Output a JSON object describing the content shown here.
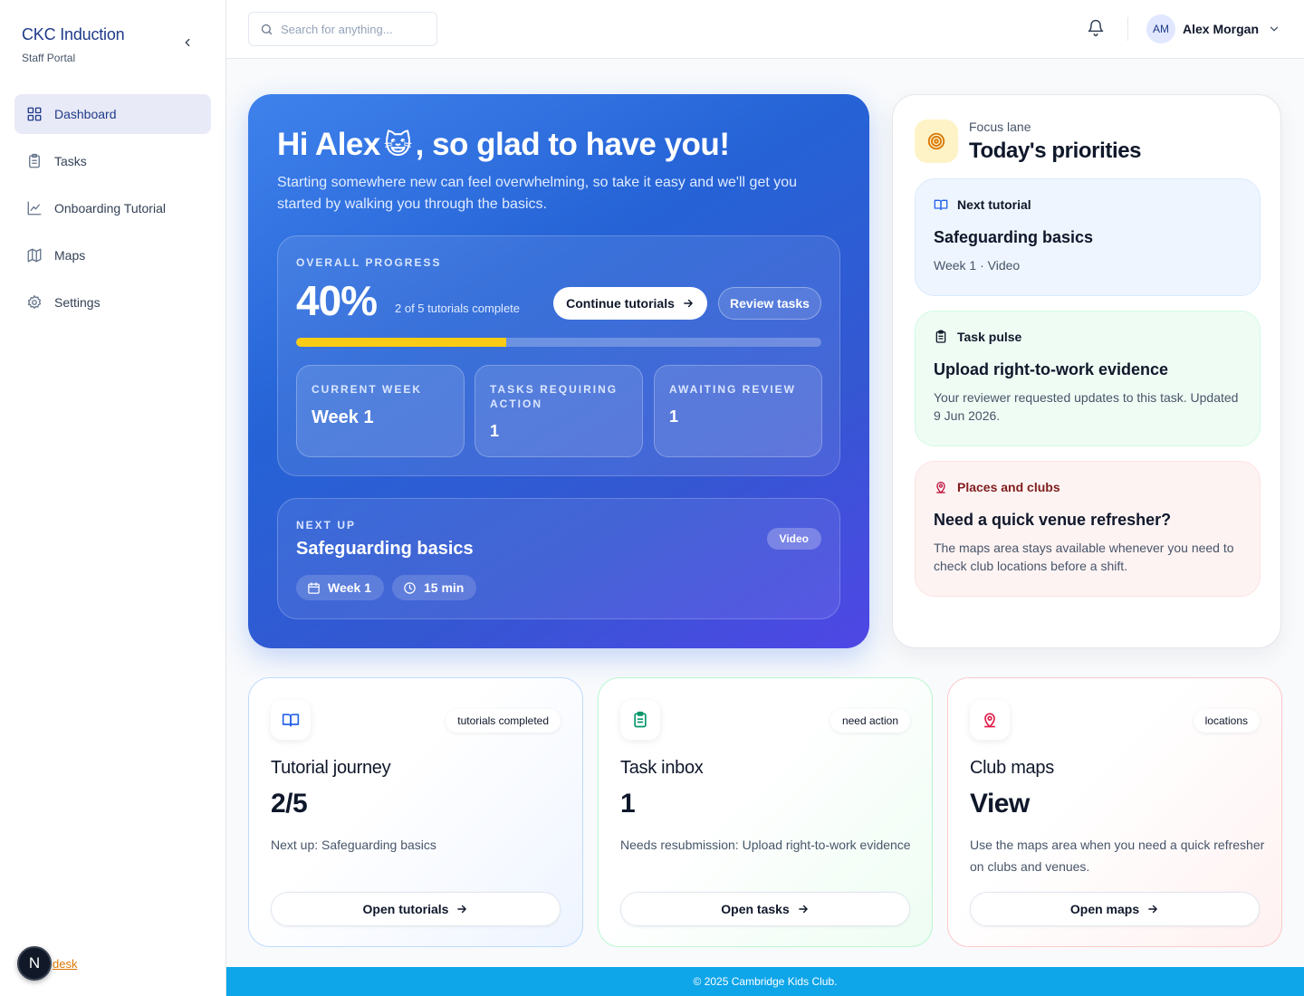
{
  "sidebar": {
    "brand_title": "CKC Induction",
    "brand_subtitle": "Staff Portal",
    "items": [
      {
        "label": "Dashboard",
        "icon": "grid-icon",
        "active": true
      },
      {
        "label": "Tasks",
        "icon": "clipboard-icon"
      },
      {
        "label": "Onboarding Tutorial",
        "icon": "chart-line-icon"
      },
      {
        "label": "Maps",
        "icon": "map-icon"
      },
      {
        "label": "Settings",
        "icon": "gear-icon"
      }
    ],
    "dev_badge": "N",
    "footer_link": "desk"
  },
  "topbar": {
    "search_placeholder": "Search for anything...",
    "user_initials": "AM",
    "user_name": "Alex Morgan"
  },
  "hero": {
    "greeting_start": "Hi Alex",
    "emoji": "😺",
    "greeting_end": ", so glad to have you!",
    "intro": "Starting somewhere new can feel overwhelming, so take it easy and we'll get you started by walking you through the basics.",
    "progress": {
      "label": "OVERALL PROGRESS",
      "percent_text": "40%",
      "percent": 0.4,
      "summary": "2 of 5 tutorials complete",
      "continue_label": "Continue tutorials",
      "review_label": "Review tasks"
    },
    "stats": [
      {
        "label": "CURRENT WEEK",
        "value": "Week 1"
      },
      {
        "label": "TASKS REQUIRING ACTION",
        "value": "1"
      },
      {
        "label": "AWAITING REVIEW",
        "value": "1"
      }
    ],
    "next_up": {
      "label": "NEXT UP",
      "title": "Safeguarding basics",
      "badge": "Video",
      "week": "Week 1",
      "duration": "15 min"
    }
  },
  "focus": {
    "kicker": "Focus lane",
    "title": "Today's priorities",
    "cards": [
      {
        "head": "Next tutorial",
        "title": "Safeguarding basics",
        "body": "Week 1 · Video"
      },
      {
        "head": "Task pulse",
        "title": "Upload right-to-work evidence",
        "body": "Your reviewer requested updates to this task. Updated 9 Jun 2026."
      },
      {
        "head": "Places and clubs",
        "title": "Need a quick venue refresher?",
        "body": "The maps area stays available whenever you need to check club locations before a shift."
      }
    ]
  },
  "bottom_cards": [
    {
      "pill": "tutorials completed",
      "title": "Tutorial journey",
      "big": "2/5",
      "desc": "Next up: Safeguarding basics",
      "button": "Open tutorials"
    },
    {
      "pill": "need action",
      "title": "Task inbox",
      "big": "1",
      "desc": "Needs resubmission: Upload right-to-work evidence",
      "button": "Open tasks"
    },
    {
      "pill": "locations",
      "title": "Club maps",
      "big": "View",
      "desc": "Use the maps area when you need a quick refresher on clubs and venues.",
      "button": "Open maps"
    }
  ],
  "footer": {
    "text": "© 2025 Cambridge Kids Club."
  },
  "colors": {
    "brand": "#1e3a8a",
    "hero_start": "#3f82ec",
    "hero_end": "#4f46e5",
    "progress_fill": "#facc15",
    "footer": "#0ea5e9"
  }
}
